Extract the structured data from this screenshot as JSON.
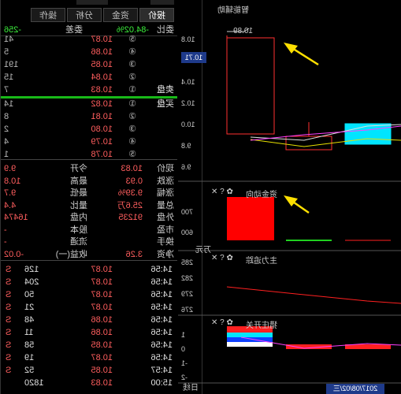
{
  "tabs": [
    "报价",
    "资金",
    "分析",
    "操作"
  ],
  "ratio": {
    "label": "委比",
    "value": "-84.02%",
    "diff_label": "委差",
    "diff": "-256"
  },
  "sell": [
    {
      "label": "",
      "idx": "⑤",
      "price": "10.87",
      "vol": "41"
    },
    {
      "label": "",
      "idx": "④",
      "price": "10.86",
      "vol": "5"
    },
    {
      "label": "",
      "idx": "③",
      "price": "10.85",
      "vol": "191"
    },
    {
      "label": "",
      "idx": "②",
      "price": "10.84",
      "vol": "15"
    },
    {
      "label": "卖盘",
      "idx": "①",
      "price": "10.83",
      "vol": "7"
    }
  ],
  "buy": [
    {
      "label": "买盘",
      "idx": "①",
      "price": "10.82",
      "vol": "14"
    },
    {
      "label": "",
      "idx": "②",
      "price": "10.81",
      "vol": "8"
    },
    {
      "label": "",
      "idx": "③",
      "price": "10.80",
      "vol": "2"
    },
    {
      "label": "",
      "idx": "④",
      "price": "10.79",
      "vol": "4"
    },
    {
      "label": "",
      "idx": "⑤",
      "price": "10.78",
      "vol": "1"
    }
  ],
  "stats": [
    {
      "l1": "现价",
      "v1": "10.83",
      "l2": "今开",
      "v2": "9.9"
    },
    {
      "l1": "涨跌",
      "v1": "0.93",
      "l2": "最高",
      "v2": "10.8"
    },
    {
      "l1": "涨幅",
      "v1": "9.39%",
      "l2": "最低",
      "v2": "9.7"
    },
    {
      "l1": "总量",
      "v1": "25.6万",
      "l2": "量比",
      "v2": "4.4"
    },
    {
      "l1": "外盘",
      "v1": "91235",
      "l2": "内盘",
      "v2": "16474"
    },
    {
      "l1": "市盈",
      "v1": "",
      "l2": "股本",
      "v2": "-"
    },
    {
      "l1": "换手",
      "v1": "",
      "l2": "流通",
      "v2": "-"
    },
    {
      "l1": "净资",
      "v1": "3.26",
      "l2": "收益(一)",
      "v2": "-0.02"
    }
  ],
  "ticks": [
    {
      "t": "14:56",
      "p": "10.87",
      "vol": "126",
      "d": "S"
    },
    {
      "t": "14:56",
      "p": "10.87",
      "vol": "204",
      "d": "S"
    },
    {
      "t": "14:56",
      "p": "10.87",
      "vol": "50",
      "d": "S"
    },
    {
      "t": "14:56",
      "p": "10.87",
      "vol": "21",
      "d": "S"
    },
    {
      "t": "14:56",
      "p": "10.86",
      "vol": "48",
      "d": "S"
    },
    {
      "t": "14:56",
      "p": "10.86",
      "vol": "11",
      "d": "S"
    },
    {
      "t": "14:56",
      "p": "10.85",
      "vol": "58",
      "d": "S"
    },
    {
      "t": "14:56",
      "p": "10.87",
      "vol": "19",
      "d": "S"
    },
    {
      "t": "14:57",
      "p": "10.85",
      "vol": "52",
      "d": "S"
    },
    {
      "t": "15:00",
      "p": "10.83",
      "vol": "1820",
      "d": ""
    }
  ],
  "chart": {
    "main_title": "智能辅助",
    "high_label": "10.89",
    "price_now": "10.71",
    "axis_main": [
      "10.8",
      "10.6",
      "10.4",
      "10.2",
      "10.0",
      "9.8",
      "9.6"
    ],
    "panel2_title": "资金动向",
    "axis_p2": [
      "700",
      "600"
    ],
    "unit_p2": "万元",
    "panel3_title": "主力追踪",
    "axis_p3": [
      "285",
      "282",
      "279",
      "276"
    ],
    "panel4_title": "猎庄开关",
    "axis_p4": [
      "1",
      "0",
      "-1",
      "-2"
    ],
    "date_tag": "2017/08/02/三",
    "bottom_lbl": "日线"
  },
  "colors": {
    "up": "#ff2020",
    "down": "#00e5ff",
    "accent": "#1e3a8a"
  }
}
